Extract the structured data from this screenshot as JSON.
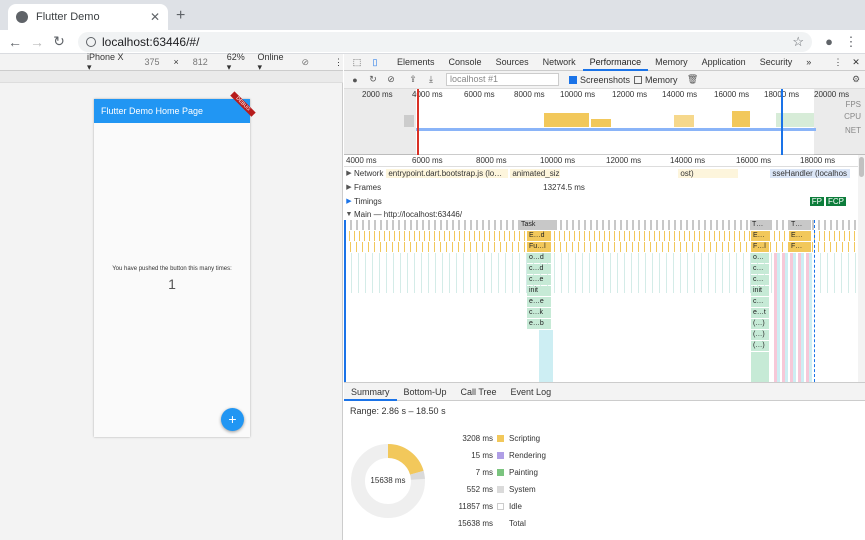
{
  "browser": {
    "tab_title": "Flutter Demo",
    "url": "localhost:63446/#/"
  },
  "device_toolbar": {
    "device": "iPhone X ▾",
    "width": "375",
    "times": "×",
    "height": "812",
    "zoom": "62% ▾",
    "network": "Online ▾"
  },
  "app": {
    "title": "Flutter Demo Home Page",
    "debug_banner": "DEBUG",
    "pushed_text": "You have pushed the button this many times:",
    "counter": "1",
    "fab_label": "+"
  },
  "devtools": {
    "tabs": [
      "Elements",
      "Console",
      "Sources",
      "Network",
      "Performance",
      "Memory",
      "Application",
      "Security",
      "»"
    ],
    "active_tab": "Performance",
    "target_placeholder": "localhost #1",
    "screenshots_label": "Screenshots",
    "memory_label": "Memory",
    "overview_ticks": [
      "2000 ms",
      "4000 ms",
      "6000 ms",
      "8000 ms",
      "10000 ms",
      "12000 ms",
      "14000 ms",
      "16000 ms",
      "18000 ms",
      "20000 ms"
    ],
    "overview_labels": [
      "FPS",
      "CPU",
      "NET"
    ],
    "ruler_ticks": [
      "4000 ms",
      "6000 ms",
      "8000 ms",
      "10000 ms",
      "12000 ms",
      "14000 ms",
      "16000 ms",
      "18000 ms"
    ],
    "tracks": {
      "network": "Network",
      "network_items": [
        "entrypoint.dart.bootstrap.js (lo…",
        "animated_siz",
        "ost)",
        "sseHandler (localhos"
      ],
      "frames": "Frames",
      "frames_value": "13274.5 ms",
      "timings": "Timings",
      "fp": "FP",
      "fcp": "FCP",
      "main": "Main — http://localhost:63446/"
    },
    "flame": {
      "task_label": "Task",
      "col1": [
        "E…d",
        "Fu…l",
        "o…d",
        "c…d",
        "c…e",
        "init",
        "e…e",
        "c…k",
        "e…b"
      ],
      "col2": [
        "E…",
        "F…l",
        "o…",
        "c…",
        "c…",
        "init",
        "c…",
        "e…t",
        "(…)",
        "(…)",
        "(…)"
      ],
      "t_labels": [
        "T…",
        "T…",
        "E…",
        "F…"
      ]
    },
    "bottom_tabs": [
      "Summary",
      "Bottom-Up",
      "Call Tree",
      "Event Log"
    ],
    "active_bottom_tab": "Summary",
    "range": "Range: 2.86 s – 18.50 s",
    "summary_total": "15638 ms",
    "summary": [
      {
        "value": "3208 ms",
        "label": "Scripting",
        "color": "#f2c85b"
      },
      {
        "value": "15 ms",
        "label": "Rendering",
        "color": "#af9ee6"
      },
      {
        "value": "7 ms",
        "label": "Painting",
        "color": "#7bc47f"
      },
      {
        "value": "552 ms",
        "label": "System",
        "color": "#dadada"
      },
      {
        "value": "11857 ms",
        "label": "Idle",
        "color": "#ffffff"
      },
      {
        "value": "15638 ms",
        "label": "Total",
        "color": ""
      }
    ]
  }
}
